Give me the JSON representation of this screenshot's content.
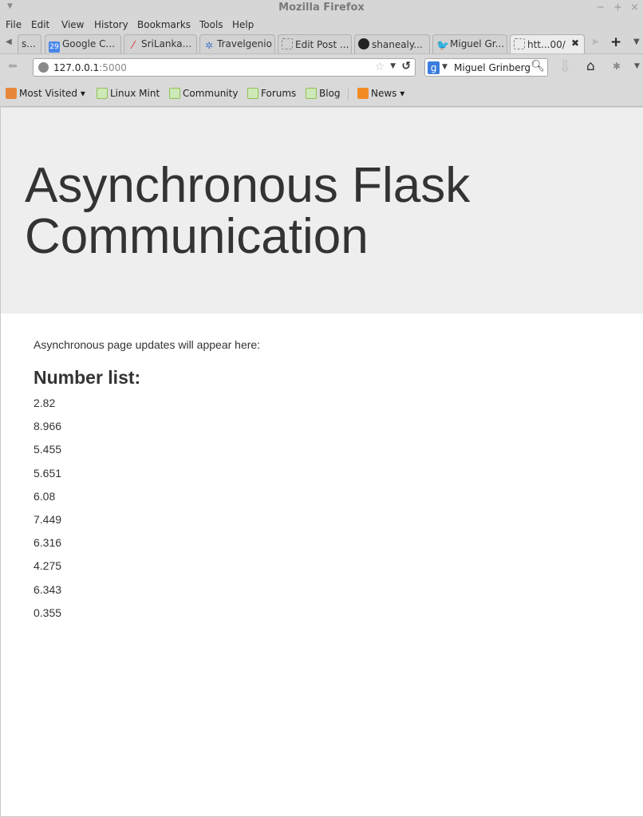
{
  "window": {
    "title": "Mozilla Firefox",
    "controls": [
      "−",
      "+",
      "×"
    ]
  },
  "menubar": {
    "items": [
      {
        "label": "File",
        "accel": "F"
      },
      {
        "label": "Edit",
        "accel": "E"
      },
      {
        "label": "View",
        "accel": "V"
      },
      {
        "label": "History",
        "accel": "s"
      },
      {
        "label": "Bookmarks",
        "accel": "B"
      },
      {
        "label": "Tools",
        "accel": "T"
      },
      {
        "label": "Help",
        "accel": "H"
      }
    ]
  },
  "tabs": [
    {
      "label": "s...",
      "icon": "none"
    },
    {
      "label": "Google C...",
      "icon": "google-calendar-icon",
      "icon_text": "29"
    },
    {
      "label": "SriLanka...",
      "icon": "srilanka-icon"
    },
    {
      "label": "Travelgenio",
      "icon": "travelgenio-icon"
    },
    {
      "label": "Edit Post ...",
      "icon": "blank-page-icon"
    },
    {
      "label": "shanealy...",
      "icon": "github-icon"
    },
    {
      "label": "Miguel Gr...",
      "icon": "twitter-icon"
    },
    {
      "label": "htt...00/",
      "icon": "blank-page-icon",
      "active": true
    }
  ],
  "navbar": {
    "url_host": "127.0.0.1",
    "url_port": ":5000",
    "search_engine": "g",
    "search_value": "Miguel Grinberg"
  },
  "bookmarks": [
    {
      "label": "Most Visited ▾",
      "icon": "folder-icon"
    },
    {
      "label": "Linux Mint",
      "icon": "mint-icon"
    },
    {
      "label": "Community",
      "icon": "mint-icon"
    },
    {
      "label": "Forums",
      "icon": "mint-icon"
    },
    {
      "label": "Blog",
      "icon": "mint-icon"
    },
    {
      "label": "News ▾",
      "icon": "rss-icon"
    }
  ],
  "page": {
    "heading": "Asynchronous Flask Communication",
    "intro": "Asynchronous page updates will appear here:",
    "list_title": "Number list:",
    "numbers": [
      "2.82",
      "8.966",
      "5.455",
      "5.651",
      "6.08",
      "7.449",
      "6.316",
      "4.275",
      "6.343",
      "0.355"
    ]
  }
}
